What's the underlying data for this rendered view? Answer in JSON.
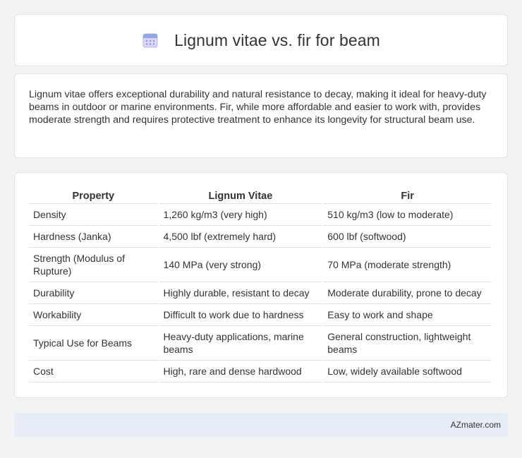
{
  "header": {
    "title": "Lignum vitae vs. fir for beam",
    "icon": "calendar-icon"
  },
  "summary": {
    "text": "Lignum vitae offers exceptional durability and natural resistance to decay, making it ideal for heavy-duty beams in outdoor or marine environments. Fir, while more affordable and easier to work with, provides moderate strength and requires protective treatment to enhance its longevity for structural beam use."
  },
  "table": {
    "headers": [
      "Property",
      "Lignum Vitae",
      "Fir"
    ],
    "rows": [
      [
        "Density",
        "1,260 kg/m3 (very high)",
        "510 kg/m3 (low to moderate)"
      ],
      [
        "Hardness (Janka)",
        "4,500 lbf (extremely hard)",
        "600 lbf (softwood)"
      ],
      [
        "Strength (Modulus of Rupture)",
        "140 MPa (very strong)",
        "70 MPa (moderate strength)"
      ],
      [
        "Durability",
        "Highly durable, resistant to decay",
        "Moderate durability, prone to decay"
      ],
      [
        "Workability",
        "Difficult to work due to hardness",
        "Easy to work and shape"
      ],
      [
        "Typical Use for Beams",
        "Heavy-duty applications, marine beams",
        "General construction, lightweight beams"
      ],
      [
        "Cost",
        "High, rare and dense hardwood",
        "Low, widely available softwood"
      ]
    ]
  },
  "footer": {
    "text": "AZmater.com"
  }
}
